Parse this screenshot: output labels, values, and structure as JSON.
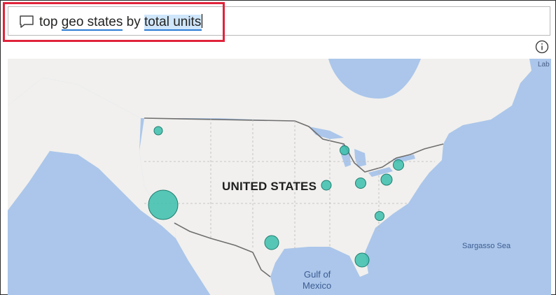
{
  "qa": {
    "query_words": [
      "top",
      "geo states",
      "by",
      "total units"
    ]
  },
  "map": {
    "country_label": "UNITED STATES",
    "gulf_label_line1": "Gulf of",
    "gulf_label_line2": "Mexico",
    "sea_label": "Sargasso Sea",
    "edge_label": "Lab",
    "bubble_color": "#3bbfad",
    "land_color": "#f1f0ee",
    "water_color": "#abc6ea"
  },
  "icons": {
    "chat": "chat-bubble-icon",
    "info": "info-icon"
  },
  "highlight_color": "#e0233b"
}
